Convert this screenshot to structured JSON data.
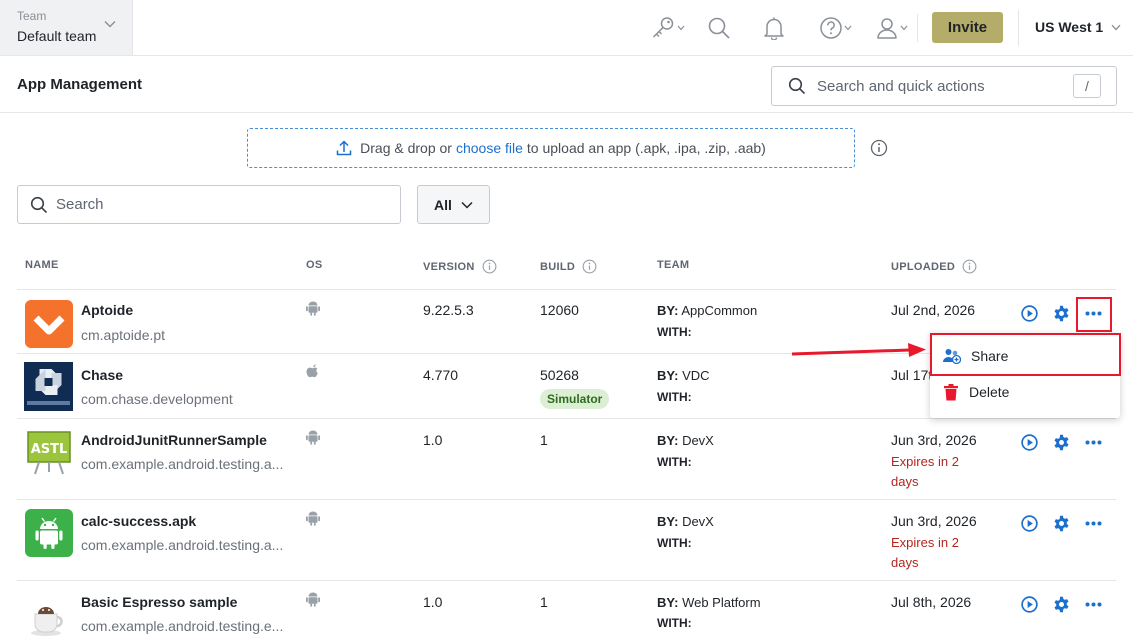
{
  "topbar": {
    "team_caption": "Team",
    "team_name": "Default team",
    "invite_label": "Invite",
    "region_label": "US West 1",
    "icons": [
      "key-icon",
      "search-icon",
      "bell-icon",
      "help-icon",
      "user-icon"
    ]
  },
  "header": {
    "title": "App Management",
    "quick_search_placeholder": "Search and quick actions",
    "quick_search_shortcut": "/"
  },
  "upload": {
    "text_before": "Drag & drop or",
    "link_text": "choose file",
    "text_after": "to upload an app (.apk, .ipa, .zip, .aab)"
  },
  "filters": {
    "search_placeholder": "Search",
    "platform_selected": "All"
  },
  "table": {
    "columns": {
      "name": "NAME",
      "os": "OS",
      "version": "VERSION",
      "build": "BUILD",
      "team": "TEAM",
      "uploaded": "UPLOADED"
    },
    "by_label": "BY:",
    "with_label": "WITH:",
    "rows": [
      {
        "name": "Aptoide",
        "package": "cm.aptoide.pt",
        "os": "android",
        "version": "9.22.5.3",
        "build": "12060",
        "badge": "",
        "by": "AppCommon",
        "uploaded": "Jul 2nd, 2026",
        "expires": ""
      },
      {
        "name": "Chase",
        "package": "com.chase.development",
        "os": "ios",
        "version": "4.770",
        "build": "50268",
        "badge": "Simulator",
        "by": "VDC",
        "uploaded": "Jul 17t",
        "expires": ""
      },
      {
        "name": "AndroidJunitRunnerSample",
        "package": "com.example.android.testing.a...",
        "os": "android",
        "version": "1.0",
        "build": "1",
        "badge": "",
        "by": "DevX",
        "uploaded": "Jun 3rd, 2026",
        "expires": "Expires in 2 days"
      },
      {
        "name": "calc-success.apk",
        "package": "com.example.android.testing.a...",
        "os": "android",
        "version": "",
        "build": "",
        "badge": "",
        "by": "DevX",
        "uploaded": "Jun 3rd, 2026",
        "expires": "Expires in 2 days"
      },
      {
        "name": "Basic Espresso sample",
        "package": "com.example.android.testing.e...",
        "os": "android",
        "version": "1.0",
        "build": "1",
        "badge": "",
        "by": "Web Platform",
        "uploaded": "Jul 8th, 2026",
        "expires": ""
      }
    ]
  },
  "context_menu": {
    "share_label": "Share",
    "delete_label": "Delete"
  },
  "colors": {
    "accent_blue": "#1d6fcd",
    "invite_bg": "#b4ad6a",
    "highlight_red": "#e8192c",
    "expires_red": "#b3261e"
  }
}
